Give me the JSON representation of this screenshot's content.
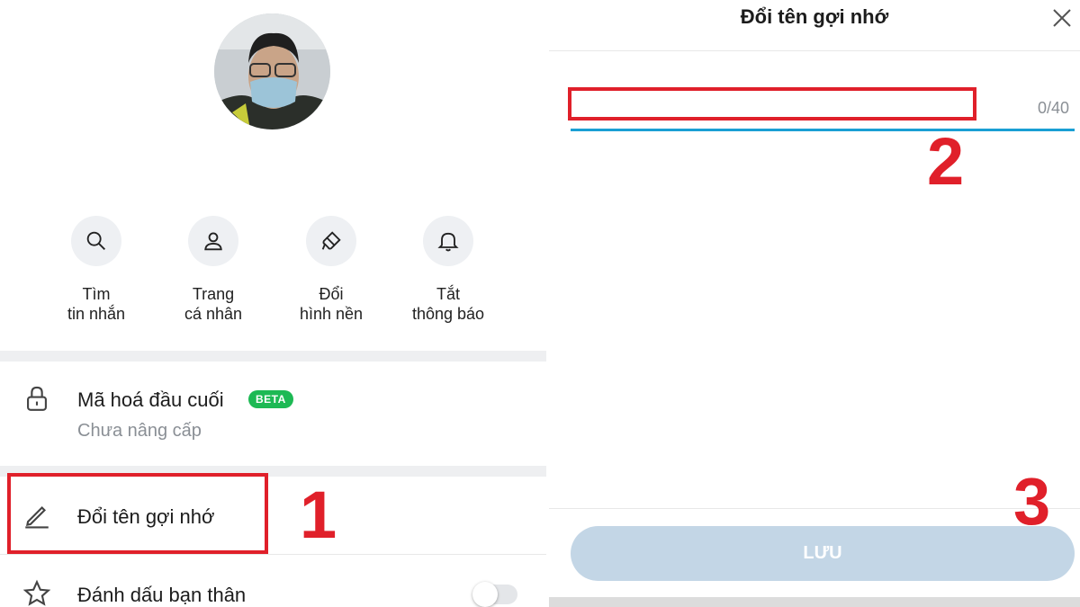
{
  "left": {
    "quick_actions": [
      {
        "label": "Tìm\ntin nhắn",
        "icon": "search-icon"
      },
      {
        "label": "Trang\ncá nhân",
        "icon": "person-icon"
      },
      {
        "label": "Đổi\nhình nền",
        "icon": "paint-brush-icon"
      },
      {
        "label": "Tắt\nthông báo",
        "icon": "bell-icon"
      }
    ],
    "encryption": {
      "title": "Mã hoá đầu cuối",
      "badge": "BETA",
      "subtitle": "Chưa nâng cấp",
      "icon": "lock-icon"
    },
    "rename": {
      "title": "Đổi tên gợi nhớ",
      "icon": "pencil-icon"
    },
    "best_friend": {
      "title": "Đánh dấu bạn thân",
      "icon": "star-icon",
      "enabled": false
    }
  },
  "annotations": {
    "step1": "1",
    "step2": "2",
    "step3": "3"
  },
  "dialog": {
    "title": "Đổi tên gợi nhớ",
    "input_value": "",
    "counter": "0/40",
    "save_label": "LƯU"
  },
  "colors": {
    "accent": "#1a9fd4",
    "annotation_red": "#e0202a",
    "beta_green": "#1db954",
    "save_disabled": "#c3d6e6"
  }
}
